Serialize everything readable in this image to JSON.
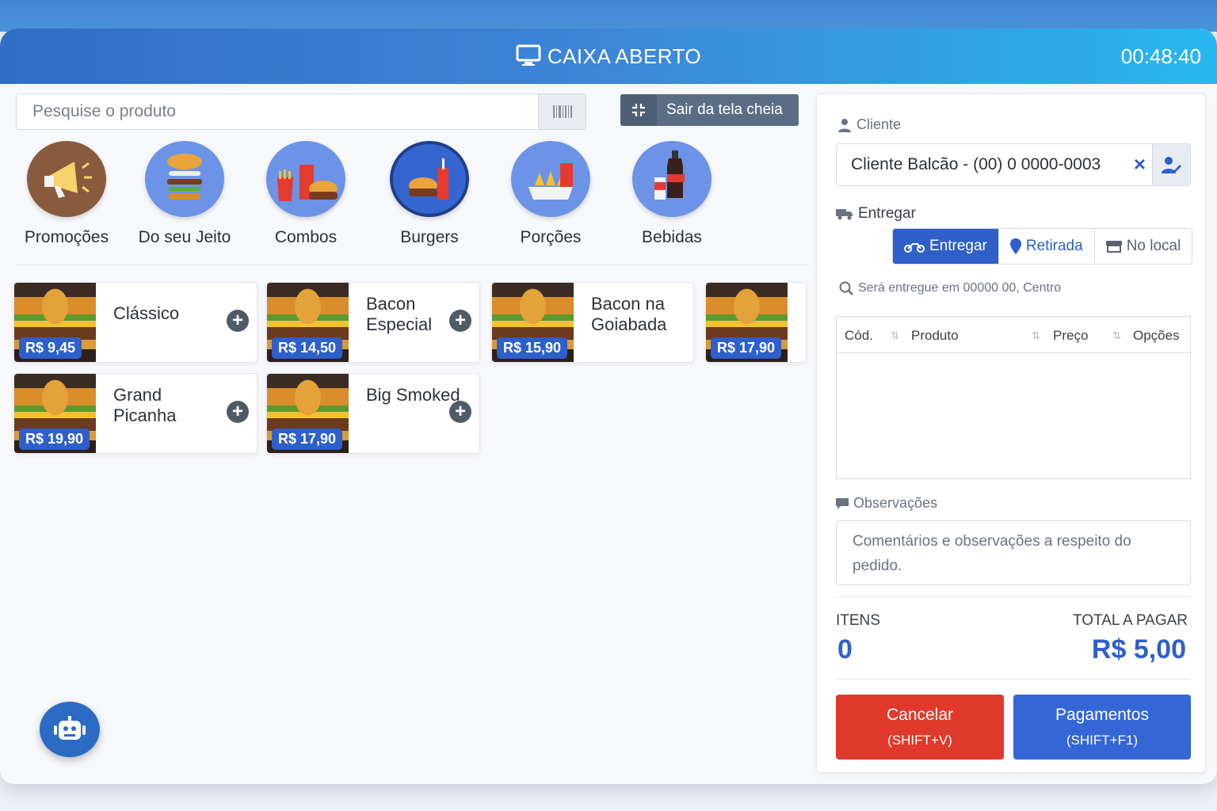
{
  "header": {
    "title": "CAIXA ABERTO",
    "clock": "00:48:40"
  },
  "search": {
    "placeholder": "Pesquise o produto",
    "fullscreen_label": "Sair da tela cheia"
  },
  "categories": [
    {
      "name": "Promoções"
    },
    {
      "name": "Do seu Jeito"
    },
    {
      "name": "Combos"
    },
    {
      "name": "Burgers"
    },
    {
      "name": "Porções"
    },
    {
      "name": "Bebidas"
    }
  ],
  "products": [
    {
      "name": "Clássico",
      "price": "R$ 9,45"
    },
    {
      "name": "Bacon Especial",
      "price": "R$ 14,50"
    },
    {
      "name": "Bacon na Goiabada",
      "price": "R$ 15,90"
    },
    {
      "name": "",
      "price": "R$ 17,90"
    },
    {
      "name": "Grand Picanha",
      "price": "R$ 19,90"
    },
    {
      "name": "Big Smoked",
      "price": "R$ 17,90"
    }
  ],
  "panel": {
    "client_label": "Cliente",
    "client_value": "Cliente Balcão - (00) 0 0000-0003",
    "delivery_label": "Entregar",
    "options": [
      "Entregar",
      "Retirada",
      "No local"
    ],
    "delivery_note": "Será entregue em 00000 00, Centro",
    "table_headers": [
      "Cód.",
      "Produto",
      "Preço",
      "Opções"
    ],
    "obs_label": "Observações",
    "obs_placeholder": "Comentários e observações a respeito do pedido.",
    "items_label": "ITENS",
    "items_value": "0",
    "total_label": "TOTAL A PAGAR",
    "total_value": "R$ 5,00",
    "cancel_label": "Cancelar",
    "cancel_shortcut": "(SHIFT+V)",
    "pay_label": "Pagamentos",
    "pay_shortcut": "(SHIFT+F1)"
  },
  "colors": {
    "accent": "#2f5fc9",
    "danger": "#e0392b",
    "header_start": "#2f6fc6",
    "header_end": "#28b7ee"
  }
}
